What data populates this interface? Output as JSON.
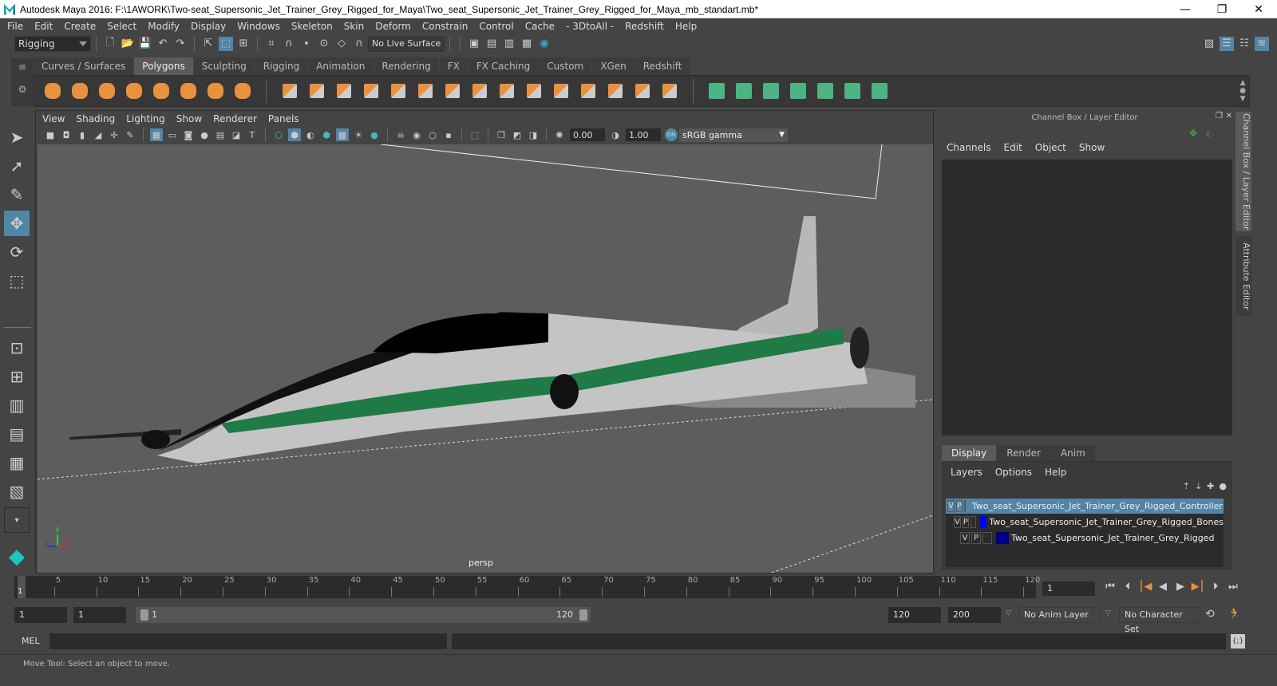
{
  "window": {
    "title": "Autodesk Maya 2016: F:\\1AWORK\\Two-seat_Supersonic_Jet_Trainer_Grey_Rigged_for_Maya\\Two_seat_Supersonic_Jet_Trainer_Grey_Rigged_for_Maya_mb_standart.mb*",
    "minimize": "—",
    "restore": "❐",
    "close": "✕"
  },
  "menu": [
    "File",
    "Edit",
    "Create",
    "Select",
    "Modify",
    "Display",
    "Windows",
    "Skeleton",
    "Skin",
    "Deform",
    "Constrain",
    "Control",
    "Cache",
    "- 3DtoAll -",
    "Redshift",
    "Help"
  ],
  "status_line": {
    "mode": "Rigging",
    "live_surface": "No Live Surface"
  },
  "shelf": {
    "tabs": [
      "Curves / Surfaces",
      "Polygons",
      "Sculpting",
      "Rigging",
      "Animation",
      "Rendering",
      "FX",
      "FX Caching",
      "Custom",
      "XGen",
      "Redshift"
    ],
    "active_tab": "Polygons",
    "poly_primitives": [
      "poly-sphere-icon",
      "poly-cube-icon",
      "poly-cylinder-icon",
      "poly-cone-icon",
      "poly-plane-icon",
      "poly-torus-icon",
      "poly-pyramid-icon",
      "poly-pipe-icon"
    ],
    "poly_tools": [
      "combine-icon",
      "separate-icon",
      "mirror-icon",
      "smooth-icon",
      "extrude-icon",
      "bridge-icon",
      "append-icon",
      "bevel-icon",
      "multicut-icon",
      "target-weld-icon",
      "insert-loop-icon",
      "offset-loop-icon",
      "bool-icon",
      "fill-hole-icon",
      "triangulate-icon"
    ],
    "uv_tools": [
      "planar-map-icon",
      "cylindrical-map-icon",
      "spherical-map-icon",
      "auto-map-icon",
      "unfold-icon",
      "uv-editor-icon",
      "layout-uv-icon"
    ]
  },
  "viewport": {
    "menu": [
      "View",
      "Shading",
      "Lighting",
      "Show",
      "Renderer",
      "Panels"
    ],
    "exposure": "0.00",
    "gamma": "1.00",
    "color_management": "ON",
    "colorspace": "sRGB gamma",
    "camera": "persp",
    "axis": {
      "x": "x",
      "y": "y",
      "z": "z"
    }
  },
  "channel_box": {
    "header": "Channel Box / Layer Editor",
    "menu": [
      "Channels",
      "Edit",
      "Object",
      "Show"
    ]
  },
  "layer_editor": {
    "tabs": [
      "Display",
      "Render",
      "Anim"
    ],
    "active_tab": "Display",
    "menu": [
      "Layers",
      "Options",
      "Help"
    ],
    "layers": [
      {
        "v": "V",
        "p": "P",
        "color": "#ff0000",
        "name": "Two_seat_Supersonic_Jet_Trainer_Grey_Rigged_Controllers",
        "selected": true
      },
      {
        "v": "V",
        "p": "P",
        "color": "#0000ff",
        "name": "Two_seat_Supersonic_Jet_Trainer_Grey_Rigged_Bones",
        "selected": false
      },
      {
        "v": "V",
        "p": "P",
        "color": "#000080",
        "name": "Two_seat_Supersonic_Jet_Trainer_Grey_Rigged",
        "selected": false
      }
    ]
  },
  "side_tabs": [
    "Channel Box / Layer Editor",
    "Attribute Editor"
  ],
  "time_slider": {
    "ticks": [
      "5",
      "10",
      "15",
      "20",
      "25",
      "30",
      "35",
      "40",
      "45",
      "50",
      "55",
      "60",
      "65",
      "70",
      "75",
      "80",
      "85",
      "90",
      "95",
      "100",
      "105",
      "110",
      "115",
      "120"
    ],
    "current_frame_marker": "1",
    "current_frame": "1"
  },
  "range_slider": {
    "start": "1",
    "anim_start": "1",
    "range_start_label": "1",
    "range_end_label": "120",
    "range_end": "120",
    "anim_end": "200",
    "anim_layer": "No Anim Layer",
    "character_set": "No Character Set"
  },
  "command_line": {
    "label": "MEL"
  },
  "status_bar": {
    "message": "Move Tool: Select an object to move."
  }
}
